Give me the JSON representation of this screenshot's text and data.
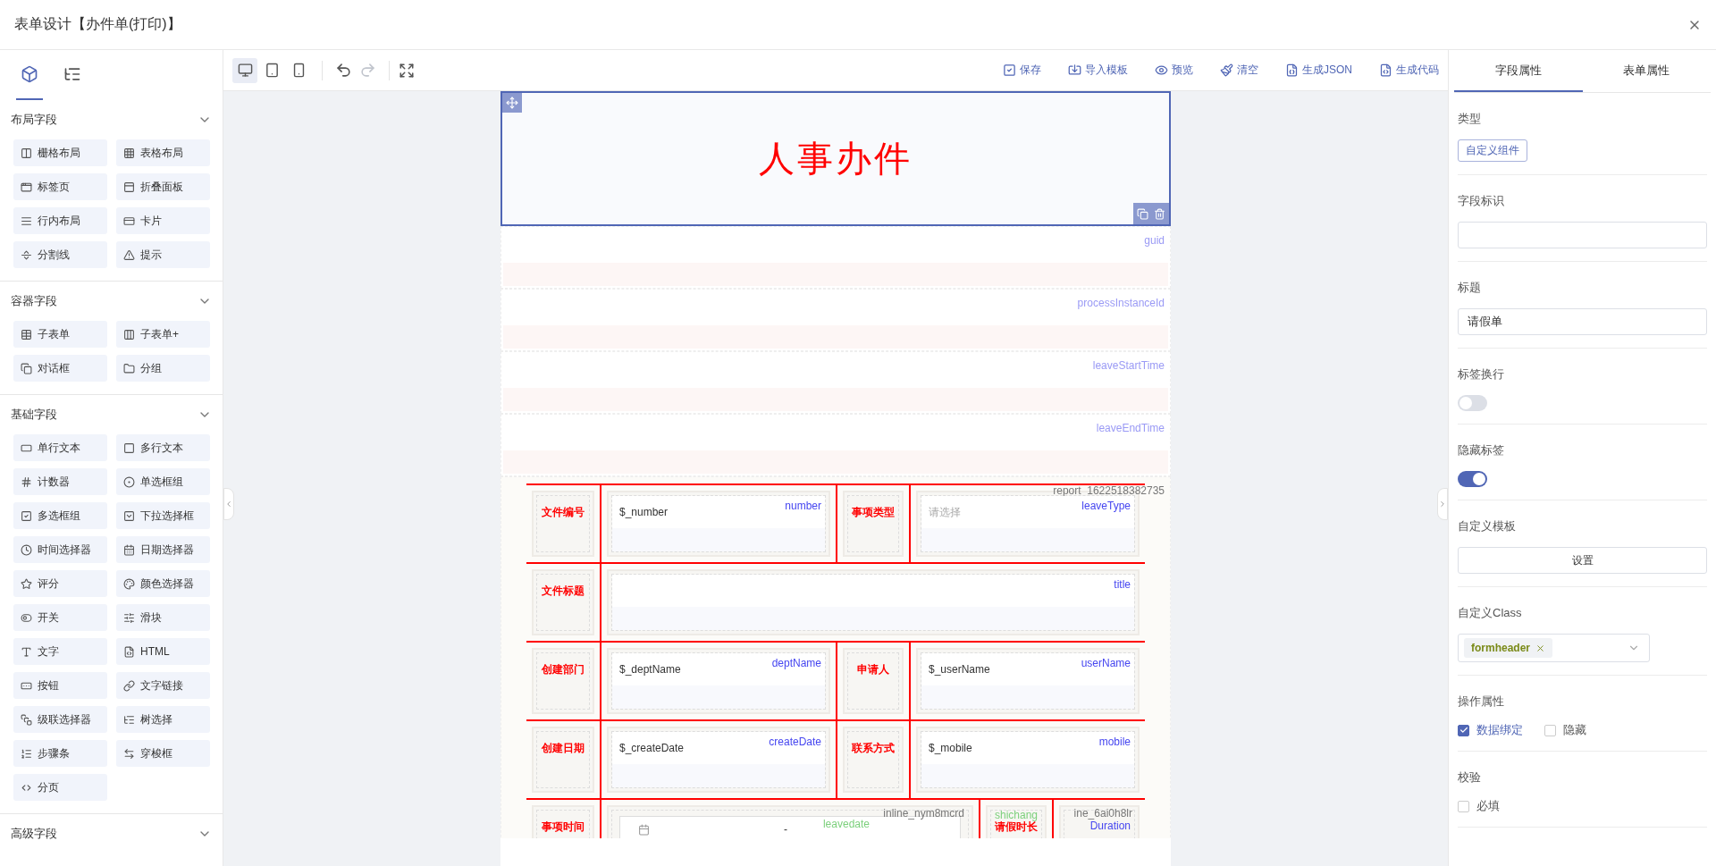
{
  "window": {
    "title": "表单设计【办件单(打印)】"
  },
  "left_panel": {
    "tabs": [
      {
        "kind": "components",
        "selected": true
      },
      {
        "kind": "tree",
        "selected": false
      }
    ],
    "groups": [
      {
        "title": "布局字段",
        "items": [
          "栅格布局",
          "表格布局",
          "标签页",
          "折叠面板",
          "行内布局",
          "卡片",
          "分割线",
          "提示"
        ]
      },
      {
        "title": "容器字段",
        "items": [
          "子表单",
          "子表单+",
          "对话框",
          "分组"
        ]
      },
      {
        "title": "基础字段",
        "items": [
          "单行文本",
          "多行文本",
          "计数器",
          "单选框组",
          "多选框组",
          "下拉选择框",
          "时间选择器",
          "日期选择器",
          "评分",
          "颜色选择器",
          "开关",
          "滑块",
          "文字",
          "HTML",
          "按钮",
          "文字链接",
          "级联选择器",
          "树选择",
          "步骤条",
          "穿梭框",
          "分页"
        ]
      },
      {
        "title": "高级字段"
      }
    ]
  },
  "toolbar": {
    "devices": [
      {
        "kind": "desktop",
        "selected": true
      },
      {
        "kind": "tablet",
        "selected": false
      },
      {
        "kind": "phone",
        "selected": false
      }
    ],
    "history": [
      {
        "kind": "undo",
        "disabled": false
      },
      {
        "kind": "redo",
        "disabled": true
      }
    ],
    "actions": [
      {
        "kind": "save",
        "label": "保存"
      },
      {
        "kind": "import",
        "label": "导入模板"
      },
      {
        "kind": "preview",
        "label": "预览"
      },
      {
        "kind": "clear",
        "label": "清空"
      },
      {
        "kind": "json",
        "label": "生成JSON"
      },
      {
        "kind": "code",
        "label": "生成代码"
      }
    ]
  },
  "canvas": {
    "header": {
      "title": "人事办件",
      "selected": true
    },
    "fields": [
      {
        "name": "guid"
      },
      {
        "name": "processInstanceId"
      },
      {
        "name": "leaveStartTime"
      },
      {
        "name": "leaveEndTime"
      }
    ],
    "report": {
      "id": "report_1622518382735",
      "rows": [
        {
          "cells": [
            {
              "kind": "label",
              "text": "文件编号"
            },
            {
              "kind": "input",
              "value": "$_number",
              "field": "number"
            },
            {
              "kind": "label",
              "text": "事项类型"
            },
            {
              "kind": "select",
              "placeholder": "请选择",
              "field": "leaveType",
              "colspan": 3
            }
          ]
        },
        {
          "cells": [
            {
              "kind": "label",
              "text": "文件标题"
            },
            {
              "kind": "input",
              "field": "title",
              "colspan": 5
            }
          ]
        },
        {
          "cells": [
            {
              "kind": "label",
              "text": "创建部门"
            },
            {
              "kind": "input",
              "value": "$_deptName",
              "field": "deptName"
            },
            {
              "kind": "label",
              "text": "申请人"
            },
            {
              "kind": "input",
              "value": "$_userName",
              "field": "userName",
              "colspan": 3
            }
          ]
        },
        {
          "cells": [
            {
              "kind": "label",
              "text": "创建日期"
            },
            {
              "kind": "input",
              "value": "$_createDate",
              "field": "createDate"
            },
            {
              "kind": "label",
              "text": "联系方式"
            },
            {
              "kind": "input",
              "value": "$_mobile",
              "field": "mobile",
              "colspan": 3
            }
          ]
        },
        {
          "cells": [
            {
              "kind": "label",
              "text": "事项时间"
            },
            {
              "kind": "daterange",
              "id": "inline_nym8mcrd",
              "field": "leavedate",
              "separator": "-",
              "colspan": 3
            },
            {
              "kind": "label",
              "text": "请假时长",
              "field": "shichang"
            },
            {
              "kind": "number",
              "id": "ine_6ai0h8lr",
              "field": "Duration"
            }
          ]
        }
      ]
    }
  },
  "right_panel": {
    "tabs": [
      {
        "label": "字段属性",
        "selected": true
      },
      {
        "label": "表单属性",
        "selected": false
      }
    ],
    "properties": [
      {
        "kind": "tag",
        "label": "类型",
        "value": "自定义组件"
      },
      {
        "kind": "input",
        "label": "字段标识"
      },
      {
        "kind": "input",
        "label": "标题",
        "value": "请假单"
      },
      {
        "kind": "switch",
        "label": "标签换行",
        "on": false
      },
      {
        "kind": "switch",
        "label": "隐藏标签",
        "on": true
      },
      {
        "kind": "button",
        "label": "自定义模板",
        "button": "设置"
      },
      {
        "kind": "select",
        "label": "自定义Class",
        "tags": [
          "formheader"
        ]
      },
      {
        "kind": "checks",
        "label": "操作属性",
        "options": [
          {
            "label": "数据绑定",
            "checked": true
          },
          {
            "label": "隐藏",
            "checked": false
          }
        ]
      },
      {
        "kind": "checks",
        "label": "校验",
        "options": [
          {
            "label": "必填",
            "checked": false
          }
        ]
      }
    ]
  }
}
